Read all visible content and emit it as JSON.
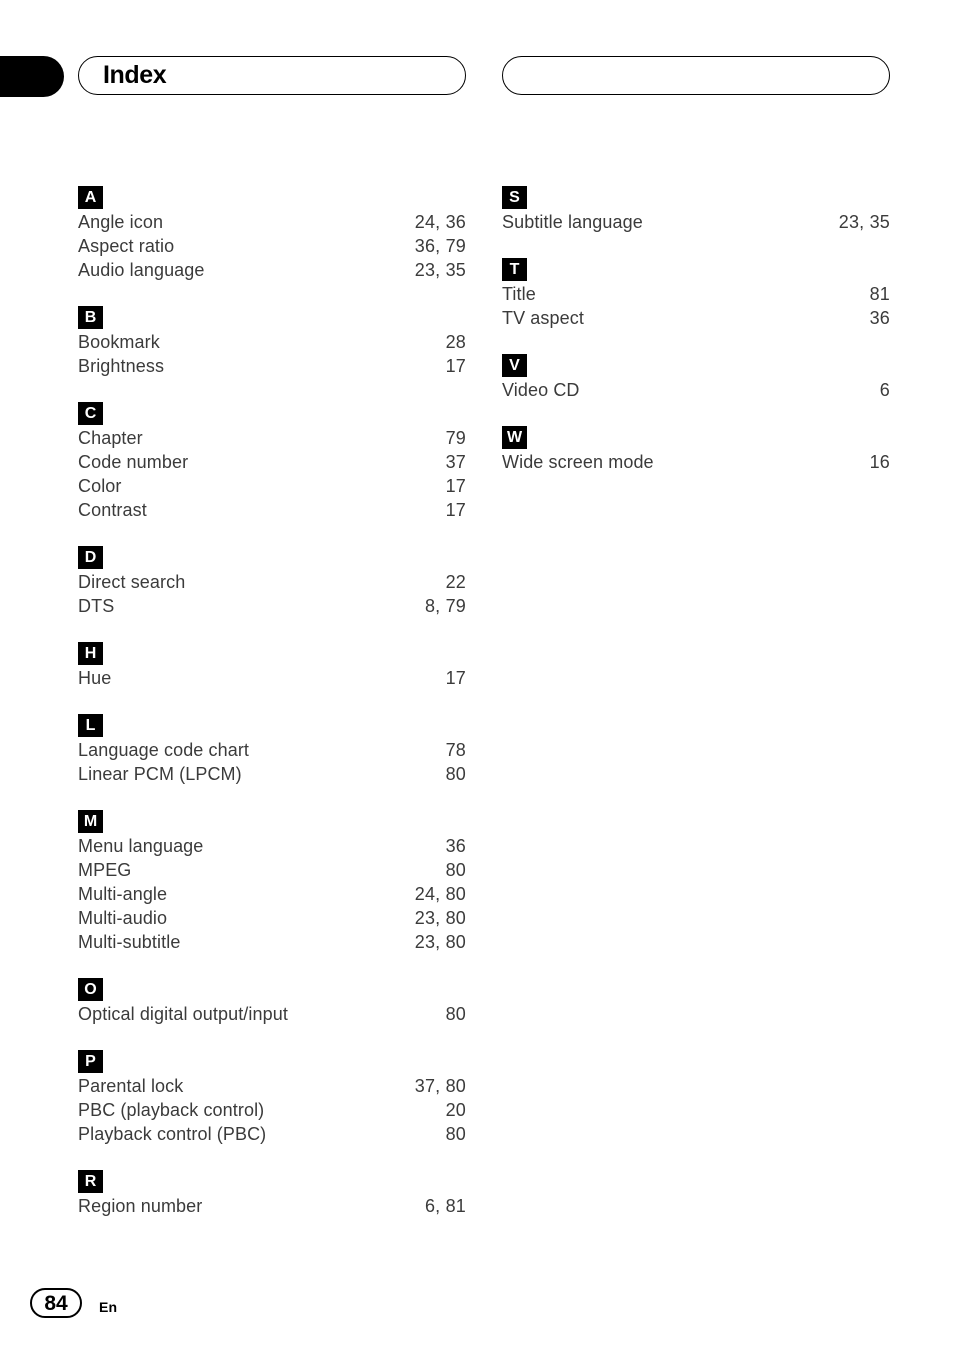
{
  "header": {
    "tab_marker": "",
    "left_title": "Index",
    "right_title": ""
  },
  "footer": {
    "page_number": "84",
    "language_code": "En"
  },
  "dot_leader": "....................................................................................................",
  "columns": [
    {
      "id": "left",
      "groups": [
        {
          "letter": "A",
          "entries": [
            {
              "label": "Angle icon",
              "pages": "24, 36"
            },
            {
              "label": "Aspect ratio",
              "pages": "36, 79"
            },
            {
              "label": "Audio language",
              "pages": "23, 35"
            }
          ]
        },
        {
          "letter": "B",
          "entries": [
            {
              "label": "Bookmark",
              "pages": "28"
            },
            {
              "label": "Brightness",
              "pages": "17"
            }
          ]
        },
        {
          "letter": "C",
          "entries": [
            {
              "label": "Chapter",
              "pages": "79"
            },
            {
              "label": "Code number",
              "pages": "37"
            },
            {
              "label": "Color",
              "pages": "17"
            },
            {
              "label": "Contrast",
              "pages": "17"
            }
          ]
        },
        {
          "letter": "D",
          "entries": [
            {
              "label": "Direct search",
              "pages": "22"
            },
            {
              "label": "DTS",
              "pages": "8, 79"
            }
          ]
        },
        {
          "letter": "H",
          "entries": [
            {
              "label": "Hue",
              "pages": "17"
            }
          ]
        },
        {
          "letter": "L",
          "entries": [
            {
              "label": "Language code chart",
              "pages": "78"
            },
            {
              "label": "Linear PCM (LPCM)",
              "pages": "80"
            }
          ]
        },
        {
          "letter": "M",
          "entries": [
            {
              "label": "Menu language",
              "pages": "36"
            },
            {
              "label": "MPEG",
              "pages": "80"
            },
            {
              "label": "Multi-angle",
              "pages": "24, 80"
            },
            {
              "label": "Multi-audio",
              "pages": "23, 80"
            },
            {
              "label": "Multi-subtitle",
              "pages": "23, 80"
            }
          ]
        },
        {
          "letter": "O",
          "entries": [
            {
              "label": "Optical digital output/input",
              "pages": "80"
            }
          ]
        },
        {
          "letter": "P",
          "entries": [
            {
              "label": "Parental lock",
              "pages": "37, 80"
            },
            {
              "label": "PBC (playback control)",
              "pages": "20"
            },
            {
              "label": "Playback control (PBC)",
              "pages": "80"
            }
          ]
        },
        {
          "letter": "R",
          "entries": [
            {
              "label": "Region number",
              "pages": "6, 81"
            }
          ]
        }
      ]
    },
    {
      "id": "right",
      "groups": [
        {
          "letter": "S",
          "entries": [
            {
              "label": "Subtitle language",
              "pages": "23, 35"
            }
          ]
        },
        {
          "letter": "T",
          "entries": [
            {
              "label": "Title",
              "pages": "81"
            },
            {
              "label": "TV aspect",
              "pages": "36"
            }
          ]
        },
        {
          "letter": "V",
          "entries": [
            {
              "label": "Video CD",
              "pages": "6"
            }
          ]
        },
        {
          "letter": "W",
          "entries": [
            {
              "label": "Wide screen mode",
              "pages": "16"
            }
          ]
        }
      ]
    }
  ]
}
